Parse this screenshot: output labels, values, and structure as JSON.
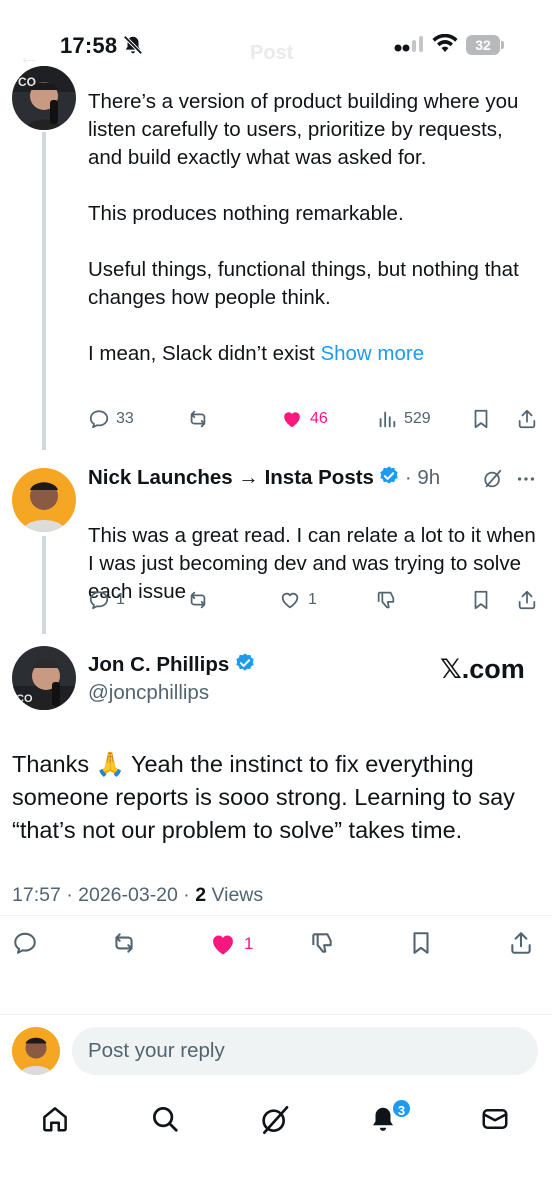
{
  "status_bar": {
    "time": "17:58",
    "battery": "32"
  },
  "header": {
    "title": "Post"
  },
  "parent_post": {
    "paragraphs": [
      "There’s a version of product building where you listen carefully to users, prioritize by requests, and build exactly what was asked for.",
      "This produces nothing remarkable.",
      "Useful things, functional things, but nothing that changes how people think."
    ],
    "truncated_text": "I mean, Slack didn’t exist",
    "show_more": "Show more",
    "replies": "33",
    "likes": "46",
    "views": "529"
  },
  "reply_post": {
    "name": "Nick Launches → Insta Posts",
    "time": "9h",
    "text": "This was a great read. I can relate a lot to it when I was just becoming dev and was trying to solve each issue",
    "replies": "1",
    "likes": "1"
  },
  "focused_post": {
    "name": "Jon C. Phillips",
    "handle": "@joncphillips",
    "source": "𝕏.com",
    "text_before_emoji": "Thanks ",
    "emoji": "🙏",
    "text_after_emoji": " Yeah the instinct to fix everything someone reports is sooo strong. Learning to say “that’s not our problem to solve” takes time.",
    "timestamp": "17:57 · 2026-03-20 · ",
    "views_count": "2",
    "views_label": " Views",
    "likes": "1"
  },
  "composer": {
    "placeholder": "Post your reply"
  },
  "bottom_nav": {
    "notifications_badge": "3",
    "items": [
      "home-icon",
      "search-icon",
      "grok-icon",
      "notifications-icon",
      "messages-icon"
    ]
  },
  "colors": {
    "accent": "#1d9bf0",
    "like": "#f91880",
    "muted": "#536471",
    "text": "#0f1419"
  }
}
